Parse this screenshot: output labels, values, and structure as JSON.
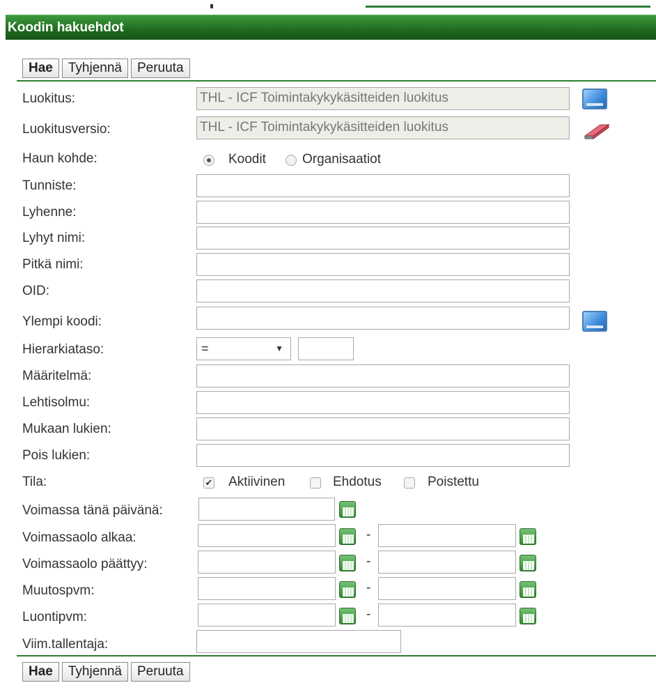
{
  "title": "Koodin hakuehdot",
  "buttons": {
    "search": "Hae",
    "clear": "Tyhjennä",
    "cancel": "Peruuta"
  },
  "fields": {
    "luokitus": {
      "label": "Luokitus:",
      "value": "THL - ICF Toimintakykykäsitteiden luokitus"
    },
    "luokitusversio": {
      "label": "Luokitusversio:",
      "value": "THL - ICF Toimintakykykäsitteiden luokitus"
    },
    "haun_kohde": {
      "label": "Haun kohde:",
      "options": [
        "Koodit",
        "Organisaatiot"
      ],
      "selected": "Koodit"
    },
    "tunniste": {
      "label": "Tunniste:"
    },
    "lyhenne": {
      "label": "Lyhenne:"
    },
    "lyhyt_nimi": {
      "label": "Lyhyt nimi:"
    },
    "pitka_nimi": {
      "label": "Pitkä nimi:"
    },
    "oid": {
      "label": "OID:"
    },
    "ylempi_koodi": {
      "label": "Ylempi koodi:"
    },
    "hierarkiataso": {
      "label": "Hierarkiataso:",
      "operator": "="
    },
    "maaritelma": {
      "label": "Määritelmä:"
    },
    "lehtisolmu": {
      "label": "Lehtisolmu:"
    },
    "mukaan_lukien": {
      "label": "Mukaan lukien:"
    },
    "pois_lukien": {
      "label": "Pois lukien:"
    },
    "tila": {
      "label": "Tila:",
      "options": [
        "Aktiivinen",
        "Ehdotus",
        "Poistettu"
      ],
      "checked": [
        "Aktiivinen"
      ]
    },
    "voimassa_tana_paivana": {
      "label": "Voimassa tänä päivänä:"
    },
    "voimassaolo_alkaa": {
      "label": "Voimassaolo alkaa:"
    },
    "voimassaolo_paattyy": {
      "label": "Voimassaolo päättyy:"
    },
    "muutospvm": {
      "label": "Muutospvm:"
    },
    "luontipvm": {
      "label": "Luontipvm:"
    },
    "viim_tallentaja": {
      "label": "Viim.tallentaja:"
    }
  },
  "range_separator": "-",
  "icons": {
    "select": "monitor-icon",
    "clear": "eraser-icon",
    "calendar": "calendar-icon"
  }
}
